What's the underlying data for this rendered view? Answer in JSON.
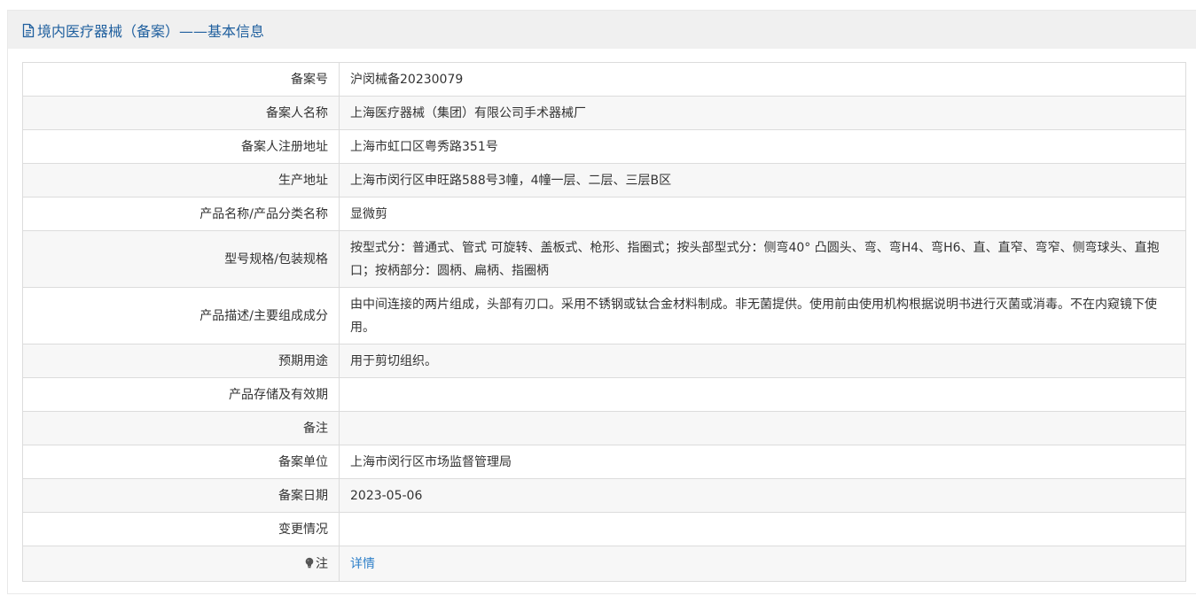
{
  "header": {
    "icon": "document-icon",
    "title": "境内医疗器械（备案）——基本信息"
  },
  "rows": [
    {
      "label": "备案号",
      "value": "沪闵械备20230079"
    },
    {
      "label": "备案人名称",
      "value": "上海医疗器械（集团）有限公司手术器械厂"
    },
    {
      "label": "备案人注册地址",
      "value": "上海市虹口区粤秀路351号"
    },
    {
      "label": "生产地址",
      "value": "上海市闵行区申旺路588号3幢，4幢一层、二层、三层B区"
    },
    {
      "label": "产品名称/产品分类名称",
      "value": "显微剪"
    },
    {
      "label": "型号规格/包装规格",
      "value": "按型式分：普通式、管式 可旋转、盖板式、枪形、指圈式；按头部型式分：侧弯40° 凸圆头、弯、弯H4、弯H6、直、直窄、弯窄、侧弯球头、直抱口；按柄部分：圆柄、扁柄、指圈柄"
    },
    {
      "label": "产品描述/主要组成成分",
      "value": "由中间连接的两片组成，头部有刃口。采用不锈钢或钛合金材料制成。非无菌提供。使用前由使用机构根据说明书进行灭菌或消毒。不在内窥镜下使用。"
    },
    {
      "label": "预期用途",
      "value": "用于剪切组织。"
    },
    {
      "label": "产品存储及有效期",
      "value": ""
    },
    {
      "label": "备注",
      "value": ""
    },
    {
      "label": "备案单位",
      "value": "上海市闵行区市场监督管理局"
    },
    {
      "label": "备案日期",
      "value": "2023-05-06"
    },
    {
      "label": "变更情况",
      "value": ""
    },
    {
      "label": "注",
      "label_icon": "lightbulb-icon",
      "value": "详情"
    }
  ],
  "colors": {
    "title": "#1f5f9e",
    "link": "#2f80c9",
    "header_bg": "#f0f0f0",
    "row_alt_bg": "#f7f7f7",
    "border": "#dcdcdc"
  }
}
